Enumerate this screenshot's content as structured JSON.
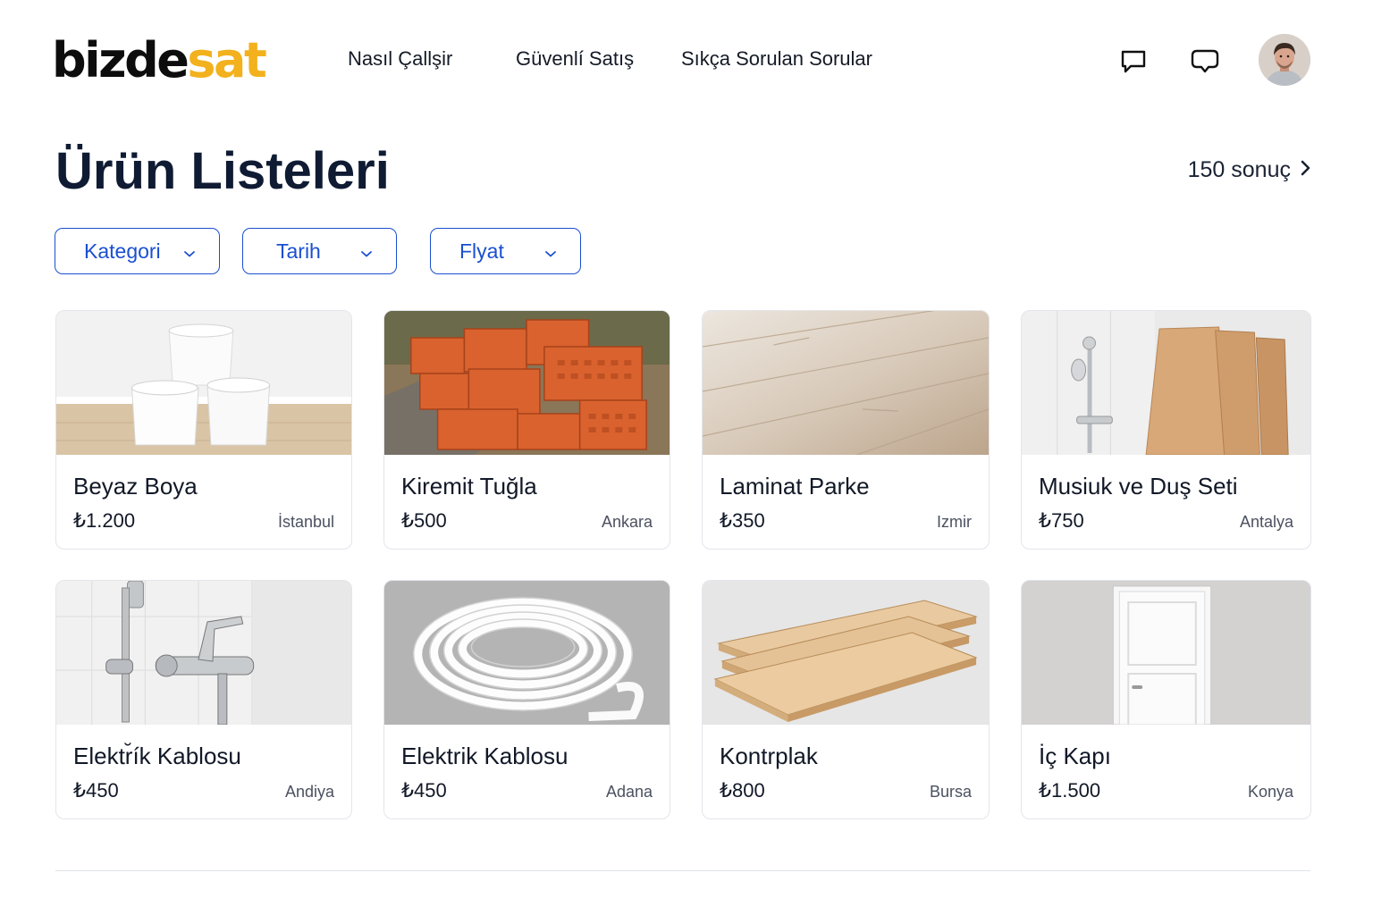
{
  "brand": {
    "part1": "bizde",
    "part2": "sat",
    "accent": "#f2b11d"
  },
  "nav": {
    "items": [
      {
        "label": "Nasıl Çallşir"
      },
      {
        "label": "Güvenlí Satış"
      },
      {
        "label": "Sıkça Sorulan Sorular"
      }
    ]
  },
  "header_icons": [
    "chat-icon",
    "message-icon",
    "avatar"
  ],
  "main": {
    "title": "Ürün Listeleri",
    "results_label": "150 sonuç"
  },
  "filters": [
    {
      "label": "Kategori"
    },
    {
      "label": "Tarih"
    },
    {
      "label": "Flyat"
    }
  ],
  "products": [
    {
      "title": "Beyaz Boya",
      "price": "₺1.200",
      "city": "İstanbul"
    },
    {
      "title": "Kiremit Tuğla",
      "price": "₺500",
      "city": "Ankara"
    },
    {
      "title": "Laminat Parke",
      "price": "₺350",
      "city": "Izmir"
    },
    {
      "title": "Musiuk ve Duş Seti",
      "price": "₺750",
      "city": "Antalya"
    },
    {
      "title": "Elektr̆ík Kablosu",
      "price": "₺450",
      "city": "Andiya"
    },
    {
      "title": "Elektrik Kablosu",
      "price": "₺450",
      "city": "Adana"
    },
    {
      "title": "Kontrplak",
      "price": "₺800",
      "city": "Bursa"
    },
    {
      "title": "İç Kapı",
      "price": "₺1.500",
      "city": "Konya"
    }
  ],
  "colors": {
    "filter_border": "#1a4fd0",
    "title": "#0f1b33"
  }
}
